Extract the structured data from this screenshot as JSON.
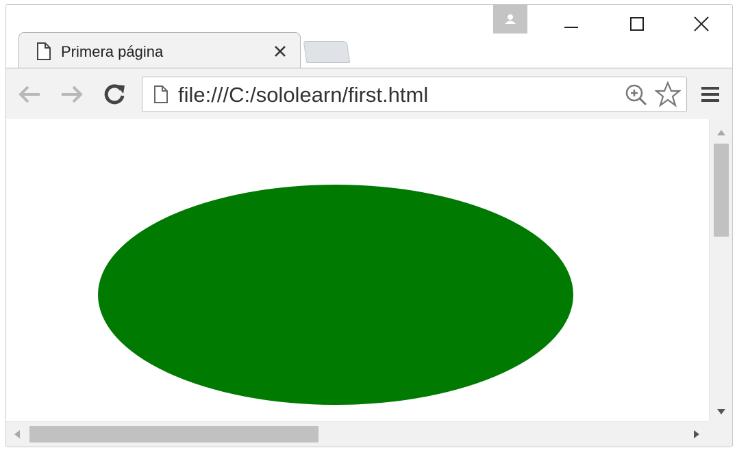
{
  "tab": {
    "title": "Primera página"
  },
  "address_bar": {
    "url": "file:///C:/sololearn/first.html"
  },
  "page": {
    "shape": "ellipse",
    "fill_color": "#007a00"
  },
  "icons": {
    "page": "page-icon",
    "close_tab": "close-icon",
    "back": "back-arrow-icon",
    "forward": "forward-arrow-icon",
    "reload": "reload-icon",
    "zoom": "zoom-in-icon",
    "bookmark": "star-icon",
    "menu": "hamburger-menu-icon",
    "profile": "user-avatar-icon",
    "minimize": "minimize-icon",
    "maximize": "maximize-icon",
    "close_window": "close-icon"
  },
  "colors": {
    "toolbar": "#f2f2f2",
    "scrollbar_thumb": "#c1c1c1",
    "ellipse": "#007a00"
  }
}
